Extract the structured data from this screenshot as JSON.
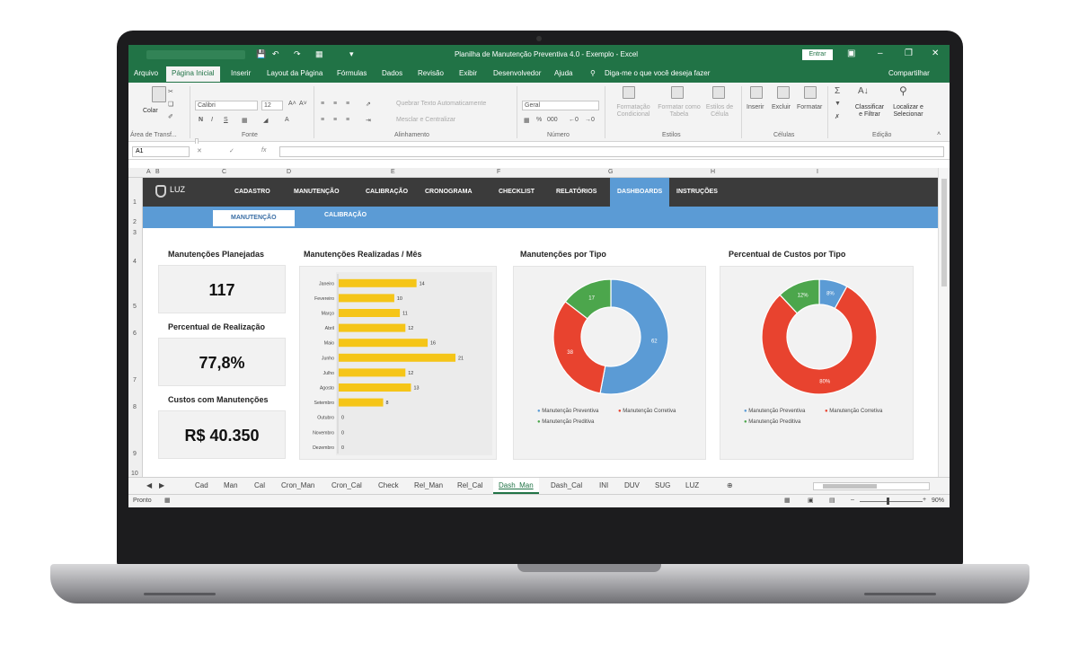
{
  "window": {
    "title": "Planilha de Manutenção Preventiva 4.0 - Exemplo - Excel",
    "entrar": "Entrar"
  },
  "ribbon_tabs": [
    "Arquivo",
    "Página Inicial",
    "Inserir",
    "Layout da Página",
    "Fórmulas",
    "Dados",
    "Revisão",
    "Exibir",
    "Desenvolvedor",
    "Ajuda"
  ],
  "tell_me": "Diga-me o que você deseja fazer",
  "share": "Compartilhar",
  "ribbon": {
    "paste": "Colar",
    "font_name": "Calibri",
    "font_size": "12",
    "wrap_text": "Quebrar Texto Automaticamente",
    "merge_center": "Mesclar e Centralizar",
    "number_format": "Geral",
    "conditional_format": "Formatação Condicional",
    "format_table": "Formatar como Tabela",
    "cell_styles": "Estilos de Célula",
    "insert": "Inserir",
    "delete": "Excluir",
    "format": "Formatar",
    "sort_filter": "Classificar e Filtrar",
    "find_select": "Localizar e Selecionar",
    "groups": [
      "Área de Transf...",
      "Fonte",
      "Alinhamento",
      "Número",
      "Estilos",
      "Células",
      "Edição"
    ]
  },
  "formula_bar": {
    "name_box": "A1",
    "fx": "fx"
  },
  "columns": [
    "A",
    "B",
    "C",
    "D",
    "E",
    "F",
    "G",
    "H",
    "I"
  ],
  "rows": [
    "1",
    "2",
    "3",
    "4",
    "5",
    "6",
    "7",
    "8",
    "9",
    "10"
  ],
  "dashboard": {
    "logo": "LUZ",
    "nav": [
      "CADASTRO",
      "MANUTENÇÃO",
      "CALIBRAÇÃO",
      "CRONOGRAMA",
      "CHECKLIST",
      "RELATÓRIOS",
      "DASHBOARDS",
      "INSTRUÇÕES"
    ],
    "subtabs": [
      "MANUTENÇÃO",
      "CALIBRAÇÃO"
    ],
    "kpi": {
      "planned_title": "Manutenções Planejadas",
      "planned_value": "117",
      "rate_title": "Percentual de Realização",
      "rate_value": "77,8%",
      "cost_title": "Custos com Manutenções",
      "cost_value": "R$ 40.350"
    }
  },
  "chart_data": [
    {
      "type": "bar",
      "title": "Manutenções Realizadas / Mês",
      "orientation": "horizontal",
      "categories": [
        "Janeiro",
        "Fevereiro",
        "Março",
        "Abril",
        "Maio",
        "Junho",
        "Julho",
        "Agosto",
        "Setembro",
        "Outubro",
        "Novembro",
        "Dezembro"
      ],
      "values": [
        14,
        10,
        11,
        12,
        16,
        21,
        12,
        13,
        8,
        0,
        0,
        0
      ],
      "color": "#f5c518"
    },
    {
      "type": "pie",
      "variant": "donut",
      "title": "Manutenções por Tipo",
      "slices": [
        {
          "name": "Manutenção Preventiva",
          "value": 62,
          "label": "62",
          "color": "#5b9bd5"
        },
        {
          "name": "Manutenção Corretiva",
          "value": 38,
          "label": "38",
          "color": "#e8432f"
        },
        {
          "name": "Manutenção Preditiva",
          "value": 17,
          "label": "17",
          "color": "#4ca64c"
        }
      ]
    },
    {
      "type": "pie",
      "variant": "donut",
      "title": "Percentual de Custos por Tipo",
      "slices": [
        {
          "name": "Manutenção Preventiva",
          "value": 8,
          "label": "8%",
          "color": "#5b9bd5"
        },
        {
          "name": "Manutenção Corretiva",
          "value": 80,
          "label": "80%",
          "color": "#e8432f"
        },
        {
          "name": "Manutenção Preditiva",
          "value": 12,
          "label": "12%",
          "color": "#4ca64c"
        }
      ]
    }
  ],
  "sheet_tabs": [
    "Cad",
    "Man",
    "Cal",
    "Cron_Man",
    "Cron_Cal",
    "Check",
    "Rel_Man",
    "Rel_Cal",
    "Dash_Man",
    "Dash_Cal",
    "INI",
    "DUV",
    "SUG",
    "LUZ"
  ],
  "active_sheet": "Dash_Man",
  "status": {
    "ready": "Pronto",
    "zoom": "90%"
  }
}
